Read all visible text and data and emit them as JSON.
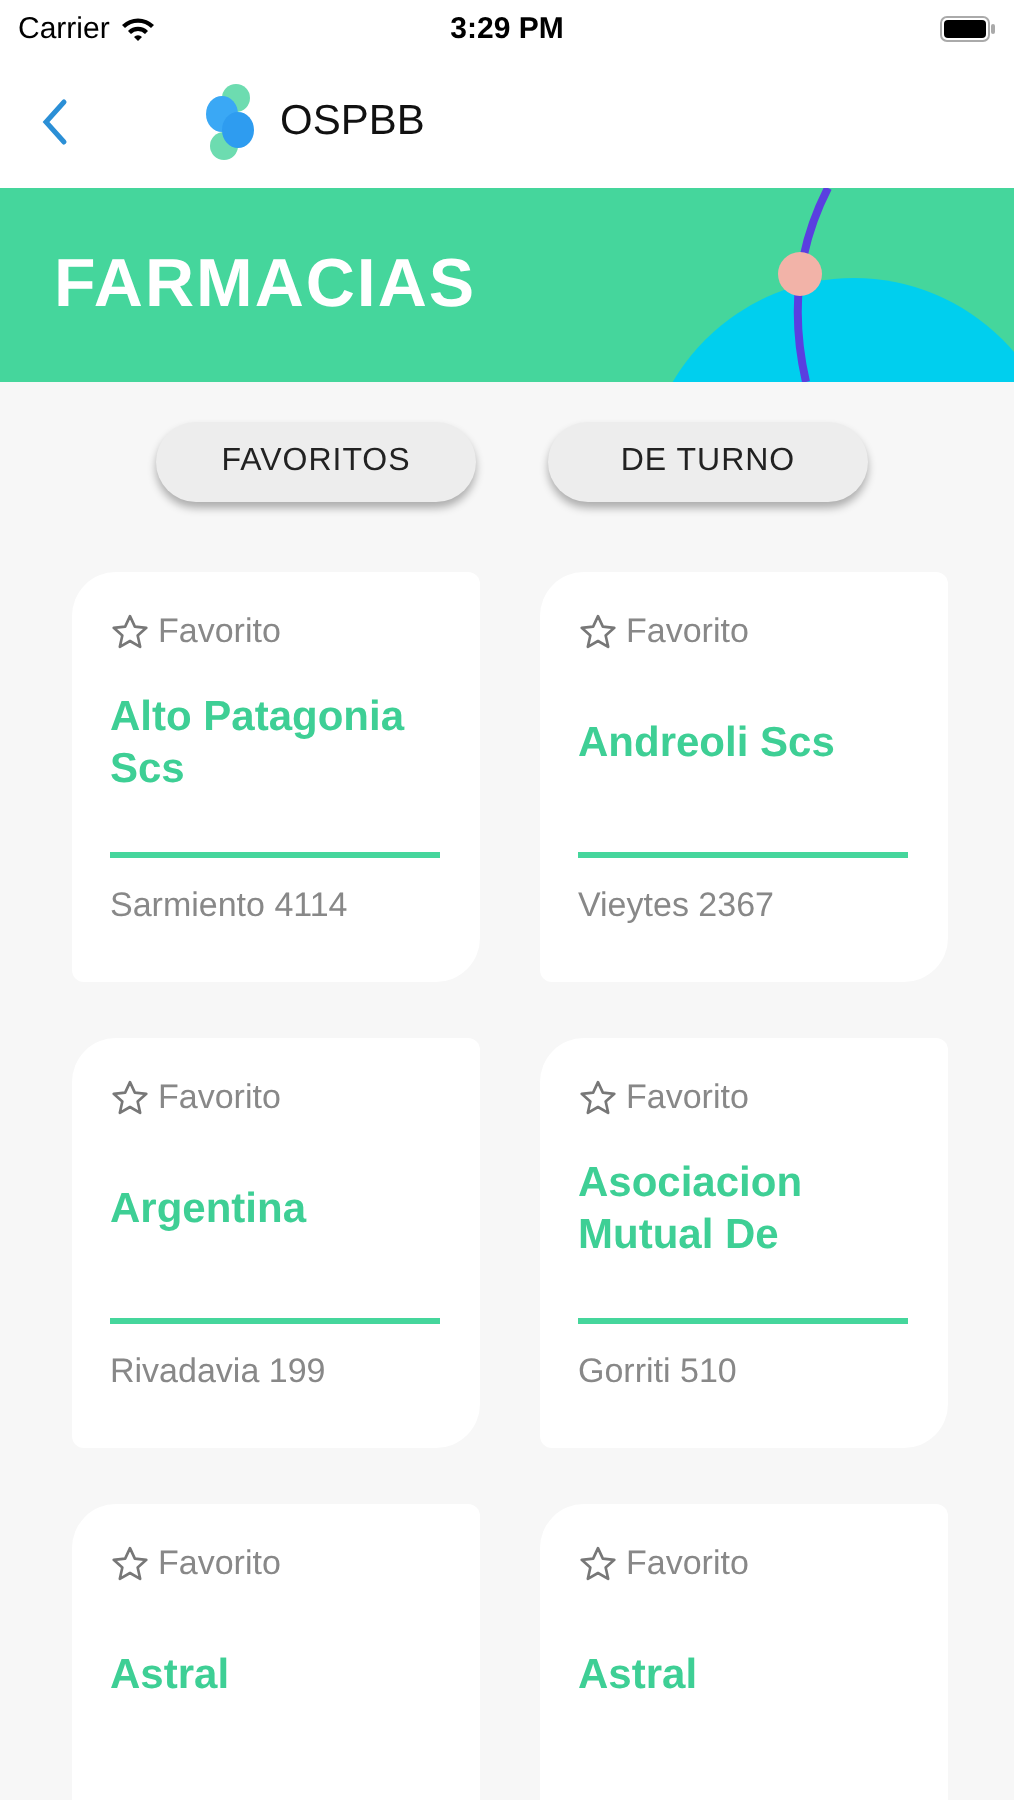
{
  "status_bar": {
    "carrier": "Carrier",
    "time": "3:29 PM"
  },
  "nav": {
    "title": "OSPBB"
  },
  "banner": {
    "title": "FARMACIAS"
  },
  "filters": [
    {
      "label": "FAVORITOS"
    },
    {
      "label": "DE TURNO"
    }
  ],
  "pharmacies": [
    {
      "favorite_label": "Favorito",
      "favorite": false,
      "name": "Alto Patagonia Scs",
      "address": "Sarmiento 4114"
    },
    {
      "favorite_label": "Favorito",
      "favorite": false,
      "name": "Andreoli Scs",
      "address": "Vieytes 2367"
    },
    {
      "favorite_label": "Favorito",
      "favorite": false,
      "name": "Argentina",
      "address": "Rivadavia 199"
    },
    {
      "favorite_label": "Favorito",
      "favorite": false,
      "name": "Asociacion Mutual De",
      "address": "Gorriti 510"
    },
    {
      "favorite_label": "Favorito",
      "favorite": false,
      "name": "Astral"
    },
    {
      "favorite_label": "Favorito",
      "favorite": false,
      "name": "Astral"
    }
  ]
}
